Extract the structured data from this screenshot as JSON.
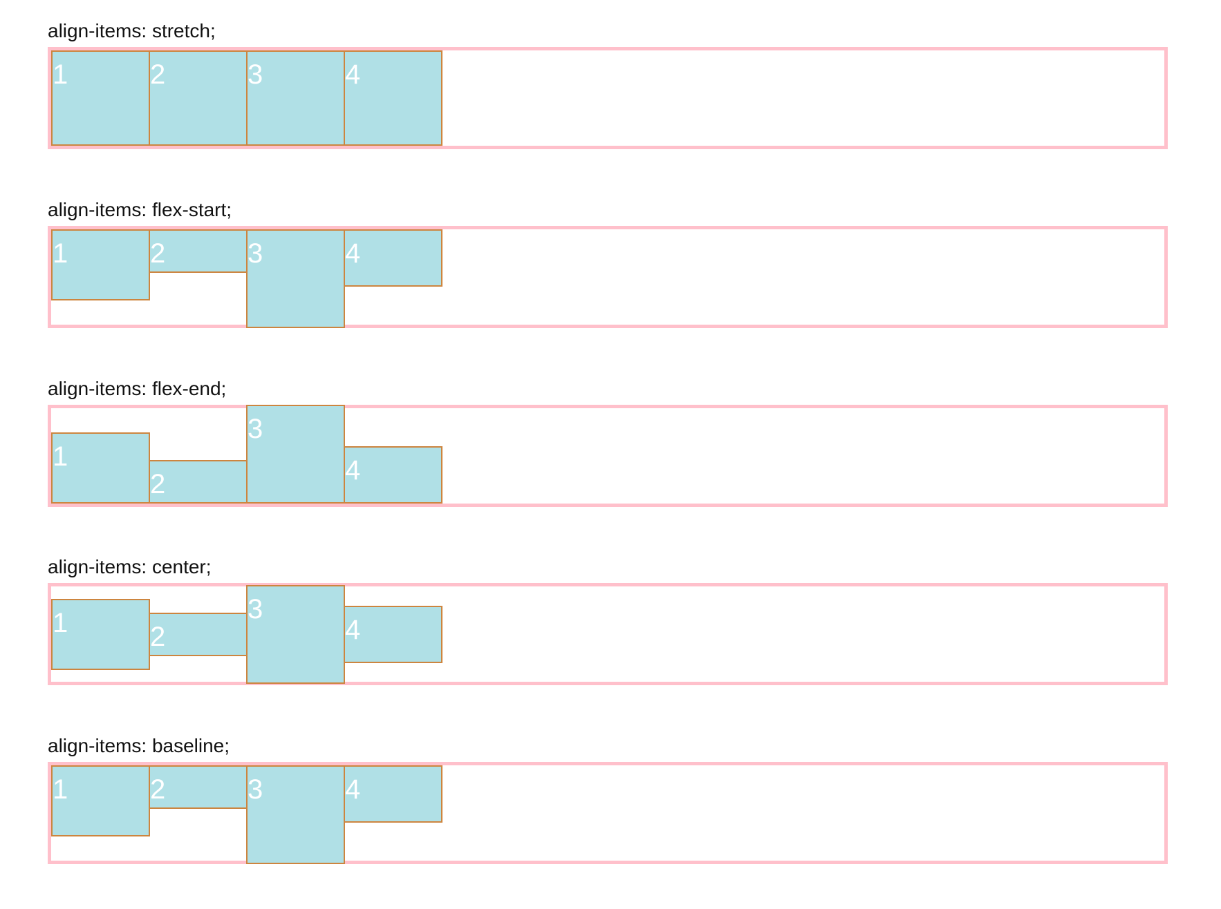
{
  "demos": [
    {
      "label": "align-items: stretch;",
      "items": [
        "1",
        "2",
        "3",
        "4"
      ]
    },
    {
      "label": "align-items: flex-start;",
      "items": [
        "1",
        "2",
        "3",
        "4"
      ]
    },
    {
      "label": "align-items: flex-end;",
      "items": [
        "1",
        "2",
        "3",
        "4"
      ]
    },
    {
      "label": "align-items: center;",
      "items": [
        "1",
        "2",
        "3",
        "4"
      ]
    },
    {
      "label": "align-items: baseline;",
      "items": [
        "1",
        "2",
        "3",
        "4"
      ]
    }
  ],
  "colors": {
    "container_border": "#ffc0cb",
    "item_background": "#b0e0e6",
    "item_border": "#cd853f",
    "item_text": "#ffffff",
    "label_text": "#111111"
  }
}
